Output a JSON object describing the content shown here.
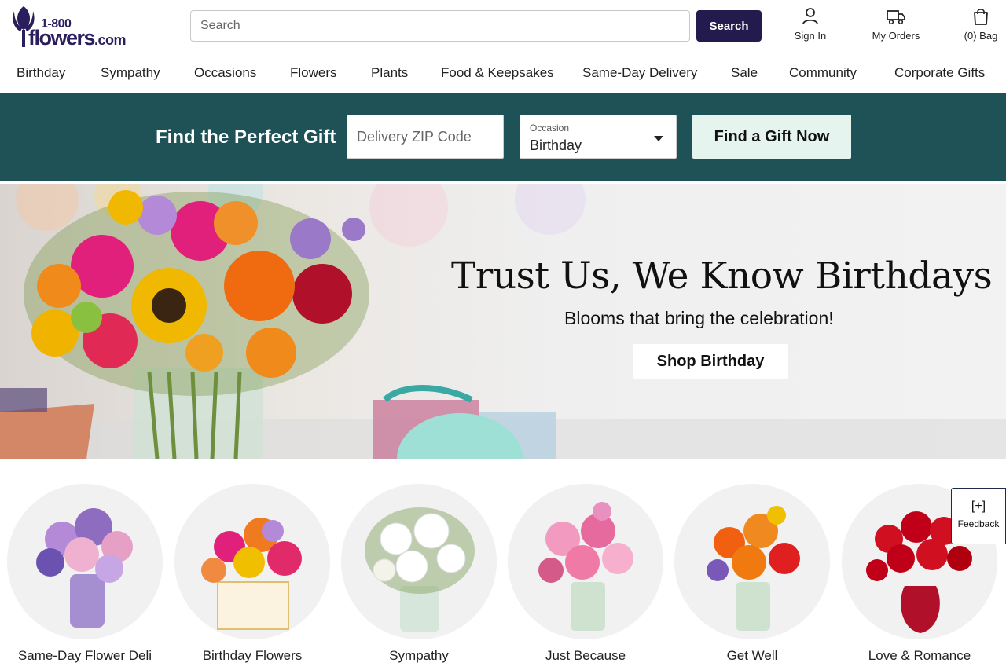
{
  "header": {
    "logo": {
      "top": "1-800",
      "main": "flowers",
      "suffix": ".com"
    },
    "search_placeholder": "Search",
    "search_button": "Search",
    "sign_in": "Sign In",
    "my_orders": "My Orders",
    "bag": "(0) Bag"
  },
  "nav": {
    "items": [
      "Birthday",
      "Sympathy",
      "Occasions",
      "Flowers",
      "Plants",
      "Food & Keepsakes",
      "Same-Day Delivery",
      "Sale",
      "Community",
      "Corporate Gifts"
    ]
  },
  "finder": {
    "title": "Find the Perfect Gift",
    "zip_placeholder": "Delivery ZIP Code",
    "occasion_label": "Occasion",
    "occasion_value": "Birthday",
    "button": "Find a Gift Now"
  },
  "hero": {
    "title": "Trust Us, We Know Birthdays",
    "subtitle": "Blooms that bring the celebration!",
    "button": "Shop Birthday"
  },
  "categories": [
    {
      "label": "Same-Day Flower Deli",
      "icon": "purple-bouquet-image"
    },
    {
      "label": "Birthday Flowers",
      "icon": "birthday-bouquet-image"
    },
    {
      "label": "Sympathy",
      "icon": "white-lily-bouquet-image"
    },
    {
      "label": "Just Because",
      "icon": "pink-bouquet-image"
    },
    {
      "label": "Get Well",
      "icon": "orange-lily-bouquet-image"
    },
    {
      "label": "Love & Romance",
      "icon": "red-rose-bouquet-image"
    }
  ],
  "feedback": {
    "symbol": "[+]",
    "label": "Feedback"
  },
  "colors": {
    "brand_purple": "#231a4d",
    "finder_band": "#1e5257",
    "find_button_bg": "#e6f4f0"
  }
}
